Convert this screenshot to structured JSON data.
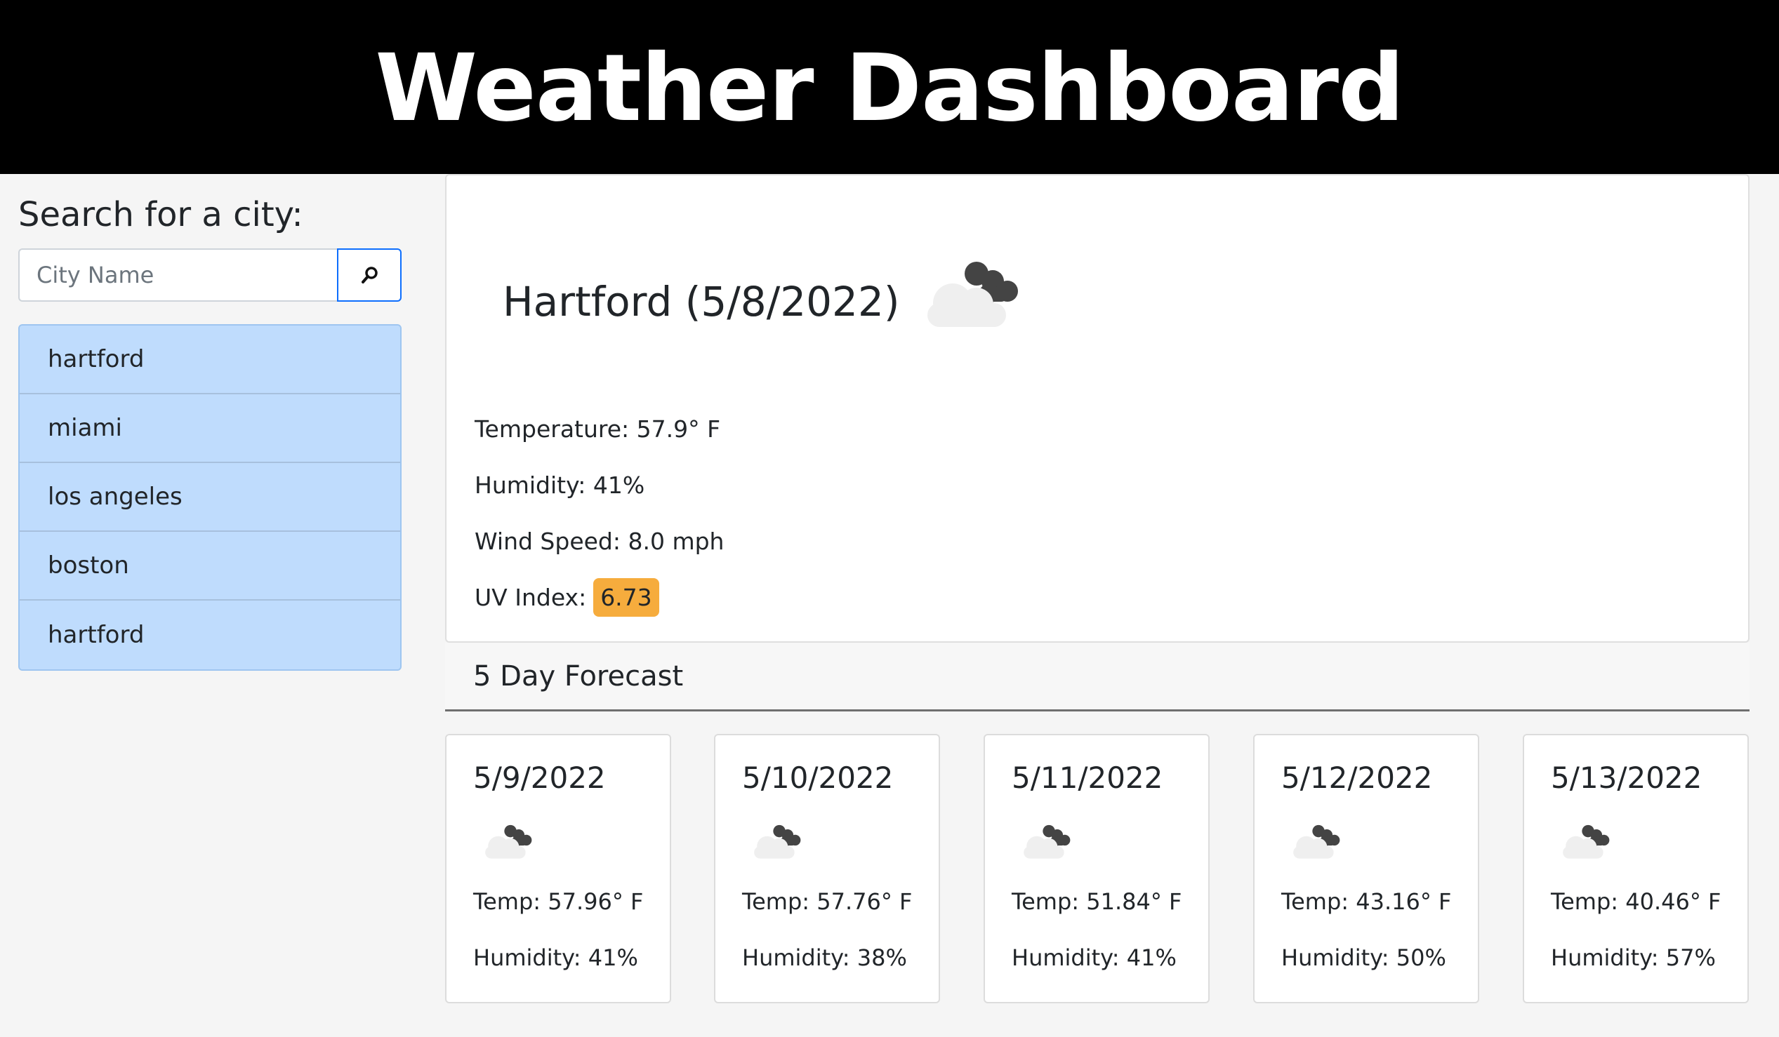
{
  "header": {
    "title": "Weather Dashboard"
  },
  "sidebar": {
    "search_label": "Search for a city:",
    "search_placeholder": "City Name",
    "search_icon": "search-icon",
    "history": [
      "hartford",
      "miami",
      "los angeles",
      "boston",
      "hartford"
    ]
  },
  "current": {
    "title": "Hartford (5/8/2022)",
    "icon": "broken-clouds-icon",
    "temperature": "Temperature: 57.9° F",
    "humidity": "Humidity: 41%",
    "wind": "Wind Speed: 8.0 mph",
    "uv_label": "UV Index:",
    "uv_value": "6.73",
    "uv_color": "#f6ac3d"
  },
  "forecast": {
    "title": "5 Day Forecast",
    "days": [
      {
        "date": "5/9/2022",
        "icon": "broken-clouds-icon",
        "temp": "Temp: 57.96° F",
        "humidity": "Humidity: 41%"
      },
      {
        "date": "5/10/2022",
        "icon": "broken-clouds-icon",
        "temp": "Temp: 57.76° F",
        "humidity": "Humidity: 38%"
      },
      {
        "date": "5/11/2022",
        "icon": "broken-clouds-icon",
        "temp": "Temp: 51.84° F",
        "humidity": "Humidity: 41%"
      },
      {
        "date": "5/12/2022",
        "icon": "broken-clouds-icon",
        "temp": "Temp: 43.16° F",
        "humidity": "Humidity: 50%"
      },
      {
        "date": "5/13/2022",
        "icon": "broken-clouds-icon",
        "temp": "Temp: 40.46° F",
        "humidity": "Humidity: 57%"
      }
    ]
  }
}
